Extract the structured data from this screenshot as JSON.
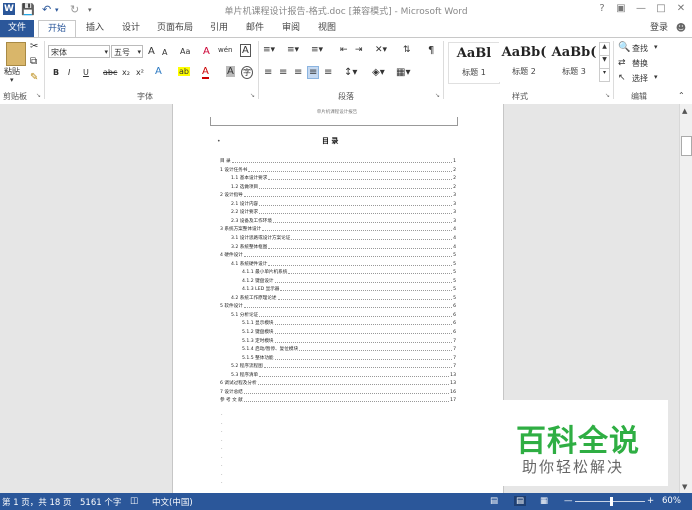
{
  "app": {
    "title": "单片机课程设计报告-格式.doc [兼容模式] - Microsoft Word",
    "help": "?",
    "login": "登录"
  },
  "tabs": {
    "file": "文件",
    "home": "开始",
    "insert": "插入",
    "design": "设计",
    "layout": "页面布局",
    "references": "引用",
    "mailings": "邮件",
    "review": "审阅",
    "view": "视图"
  },
  "ribbon": {
    "clipboard": {
      "paste": "粘贴",
      "label": "剪贴板"
    },
    "font": {
      "name": "宋体",
      "size": "五号",
      "grow": "A",
      "shrink": "A",
      "case": "Aa",
      "clear": "A",
      "phonetic": "wén",
      "border": "A",
      "bold": "B",
      "italic": "I",
      "underline": "U",
      "strike": "abc",
      "sub": "x₂",
      "sup": "x²",
      "effects": "A",
      "highlight": "ab",
      "color": "A",
      "shade": "A",
      "circle": "字",
      "label": "字体"
    },
    "paragraph": {
      "label": "段落"
    },
    "styles": {
      "items": [
        {
          "sample": "AaBl",
          "name": "标题 1"
        },
        {
          "sample": "AaBb(",
          "name": "标题 2"
        },
        {
          "sample": "AaBb(",
          "name": "标题 3"
        }
      ],
      "label": "样式"
    },
    "editing": {
      "find": "查找",
      "replace": "替换",
      "select": "选择",
      "label": "编辑"
    }
  },
  "document": {
    "header": "单片机课程设计报告",
    "toc_title": "目 录",
    "toc": [
      {
        "text": "目 录",
        "page": "1"
      },
      {
        "text": "1 设计任务书",
        "page": "2"
      },
      {
        "text": "1.1 基本设计要求",
        "page": "2"
      },
      {
        "text": "1.2 选做项目",
        "page": "2"
      },
      {
        "text": "2 设计指导",
        "page": "3"
      },
      {
        "text": "2.1 设计内容",
        "page": "3"
      },
      {
        "text": "2.2 设计要求",
        "page": "3"
      },
      {
        "text": "2.3 设备及工作环境",
        "page": "3"
      },
      {
        "text": "3 系统方案整体设计",
        "page": "4"
      },
      {
        "text": "3.1 设计思路或设计方案论证",
        "page": "4"
      },
      {
        "text": "3.2 系统整体框图",
        "page": "4"
      },
      {
        "text": "4 硬件设计",
        "page": "5"
      },
      {
        "text": "4.1 系统硬件设计",
        "page": "5"
      },
      {
        "text": "4.1.1 最小单片机系统",
        "page": "5"
      },
      {
        "text": "4.1.2 键盘设计",
        "page": "5"
      },
      {
        "text": "4.1.3 LED 显示器",
        "page": "5"
      },
      {
        "text": "4.2 系统工作原理论述",
        "page": "5"
      },
      {
        "text": "5 软件设计",
        "page": "6"
      },
      {
        "text": "5.1 分析论证",
        "page": "6"
      },
      {
        "text": "5.1.1 显示模块",
        "page": "6"
      },
      {
        "text": "5.1.2 键盘模块",
        "page": "6"
      },
      {
        "text": "5.1.3 定时模块",
        "page": "7"
      },
      {
        "text": "5.1.4 启动/暂停、复位模块",
        "page": "7"
      },
      {
        "text": "5.1.5 整体功能",
        "page": "7"
      },
      {
        "text": "5.2 程序流程图",
        "page": "7"
      },
      {
        "text": "5.3 程序清单",
        "page": "13"
      },
      {
        "text": "6 调试过程及分析",
        "page": "13"
      },
      {
        "text": "7 设计总结",
        "page": "16"
      },
      {
        "text": "参 考 文 献",
        "page": "17"
      }
    ]
  },
  "watermark": {
    "title": "百科全说",
    "subtitle": "助你轻松解决"
  },
  "status": {
    "page": "第 1 页，共 18 页",
    "words": "5161 个字",
    "lang": "中文(中国)",
    "zoom": "60%",
    "zoom_level": 0.6
  },
  "colors": {
    "accent": "#2b579a",
    "watermark_green": "#2fae43"
  }
}
